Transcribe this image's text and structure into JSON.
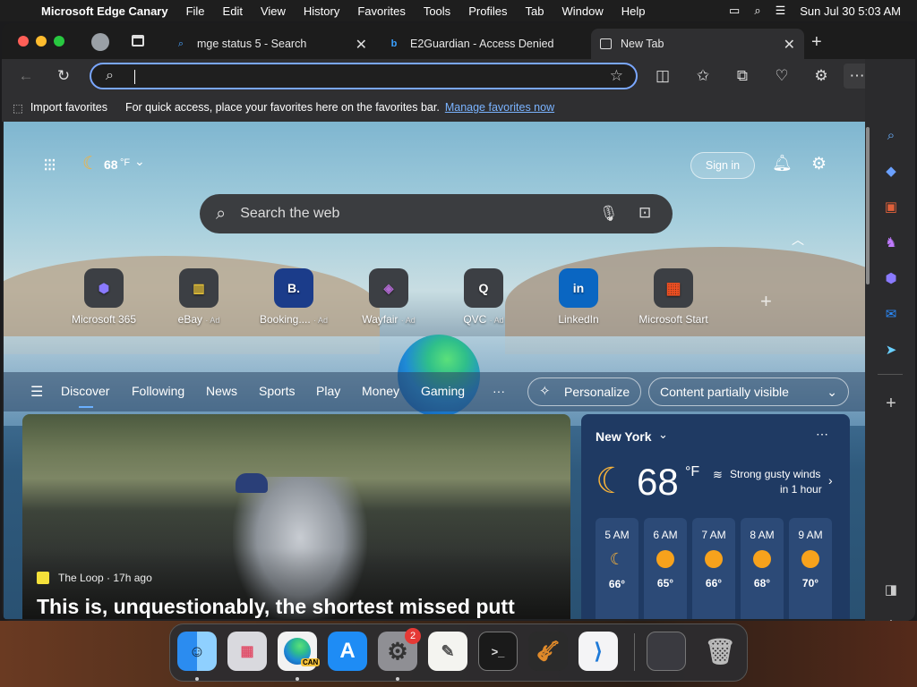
{
  "menubar": {
    "app": "Microsoft Edge Canary",
    "items": [
      "File",
      "Edit",
      "View",
      "History",
      "Favorites",
      "Tools",
      "Profiles",
      "Tab",
      "Window",
      "Help"
    ],
    "clock": "Sun Jul 30  5:03 AM"
  },
  "tabs": [
    {
      "title": "mge status 5 - Search",
      "icon": "search-icon"
    },
    {
      "title": "E2Guardian - Access Denied",
      "icon": "bing-icon"
    },
    {
      "title": "New Tab",
      "icon": "newtab-icon",
      "active": true
    }
  ],
  "favbar": {
    "import": "Import favorites",
    "hint": "For quick access, place your favorites here on the favorites bar.",
    "manage": "Manage favorites now"
  },
  "page": {
    "temp": "68",
    "temp_unit": "°F",
    "signin": "Sign in",
    "search_placeholder": "Search the web",
    "quicklinks": [
      {
        "label": "Microsoft 365",
        "ad": ""
      },
      {
        "label": "eBay",
        "ad": "· Ad"
      },
      {
        "label": "Booking....",
        "ad": "· Ad"
      },
      {
        "label": "Wayfair",
        "ad": "· Ad"
      },
      {
        "label": "QVC",
        "ad": "· Ad"
      },
      {
        "label": "LinkedIn",
        "ad": ""
      },
      {
        "label": "Microsoft Start",
        "ad": ""
      }
    ],
    "nav": [
      "Discover",
      "Following",
      "News",
      "Sports",
      "Play",
      "Money",
      "Gaming"
    ],
    "more": "···",
    "personalize": "Personalize",
    "content_select": "Content partially visible",
    "story": {
      "source": "The Loop · 17h ago",
      "headline": "This is, unquestionably, the shortest missed putt"
    },
    "weather": {
      "city": "New York",
      "temp": "68",
      "unit": "°F",
      "alert_line1": "Strong gusty winds",
      "alert_line2": "in 1 hour",
      "hours": [
        {
          "time": "5 AM",
          "temp": "66°"
        },
        {
          "time": "6 AM",
          "temp": "65°"
        },
        {
          "time": "7 AM",
          "temp": "66°"
        },
        {
          "time": "8 AM",
          "temp": "68°"
        },
        {
          "time": "9 AM",
          "temp": "70°"
        }
      ]
    }
  },
  "dock": {
    "badge": "2",
    "edge_label": "CAN"
  }
}
